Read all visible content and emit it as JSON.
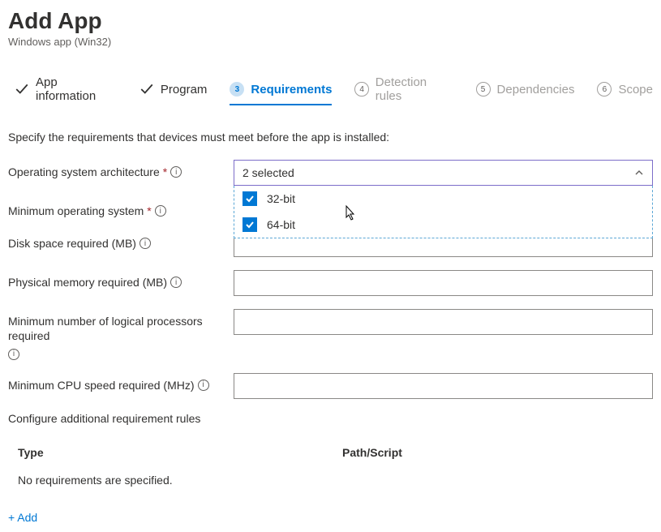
{
  "header": {
    "title": "Add App",
    "subtitle": "Windows app (Win32)"
  },
  "tabs": [
    {
      "label": "App information",
      "state": "done"
    },
    {
      "label": "Program",
      "state": "done"
    },
    {
      "label": "Requirements",
      "num": "3",
      "state": "active"
    },
    {
      "label": "Detection rules",
      "num": "4",
      "state": "pending"
    },
    {
      "label": "Dependencies",
      "num": "5",
      "state": "pending"
    },
    {
      "label": "Scope",
      "num": "6",
      "state": "pending"
    }
  ],
  "section": {
    "description": "Specify the requirements that devices must meet before the app is installed:"
  },
  "fields": {
    "os_arch": {
      "label": "Operating system architecture",
      "required": true,
      "selected_text": "2 selected",
      "options": [
        {
          "label": "32-bit",
          "checked": true
        },
        {
          "label": "64-bit",
          "checked": true
        }
      ]
    },
    "min_os": {
      "label": "Minimum operating system",
      "required": true,
      "value": ""
    },
    "disk": {
      "label": "Disk space required (MB)",
      "required": false,
      "value": ""
    },
    "memory": {
      "label": "Physical memory required (MB)",
      "required": false,
      "value": ""
    },
    "cpu_count": {
      "label": "Minimum number of logical processors required",
      "required": false,
      "value": ""
    },
    "cpu_speed": {
      "label": "Minimum CPU speed required (MHz)",
      "required": false,
      "value": ""
    }
  },
  "rules": {
    "header": "Configure additional requirement rules",
    "columns": {
      "type": "Type",
      "path": "Path/Script"
    },
    "empty": "No requirements are specified.",
    "add": "+ Add"
  }
}
